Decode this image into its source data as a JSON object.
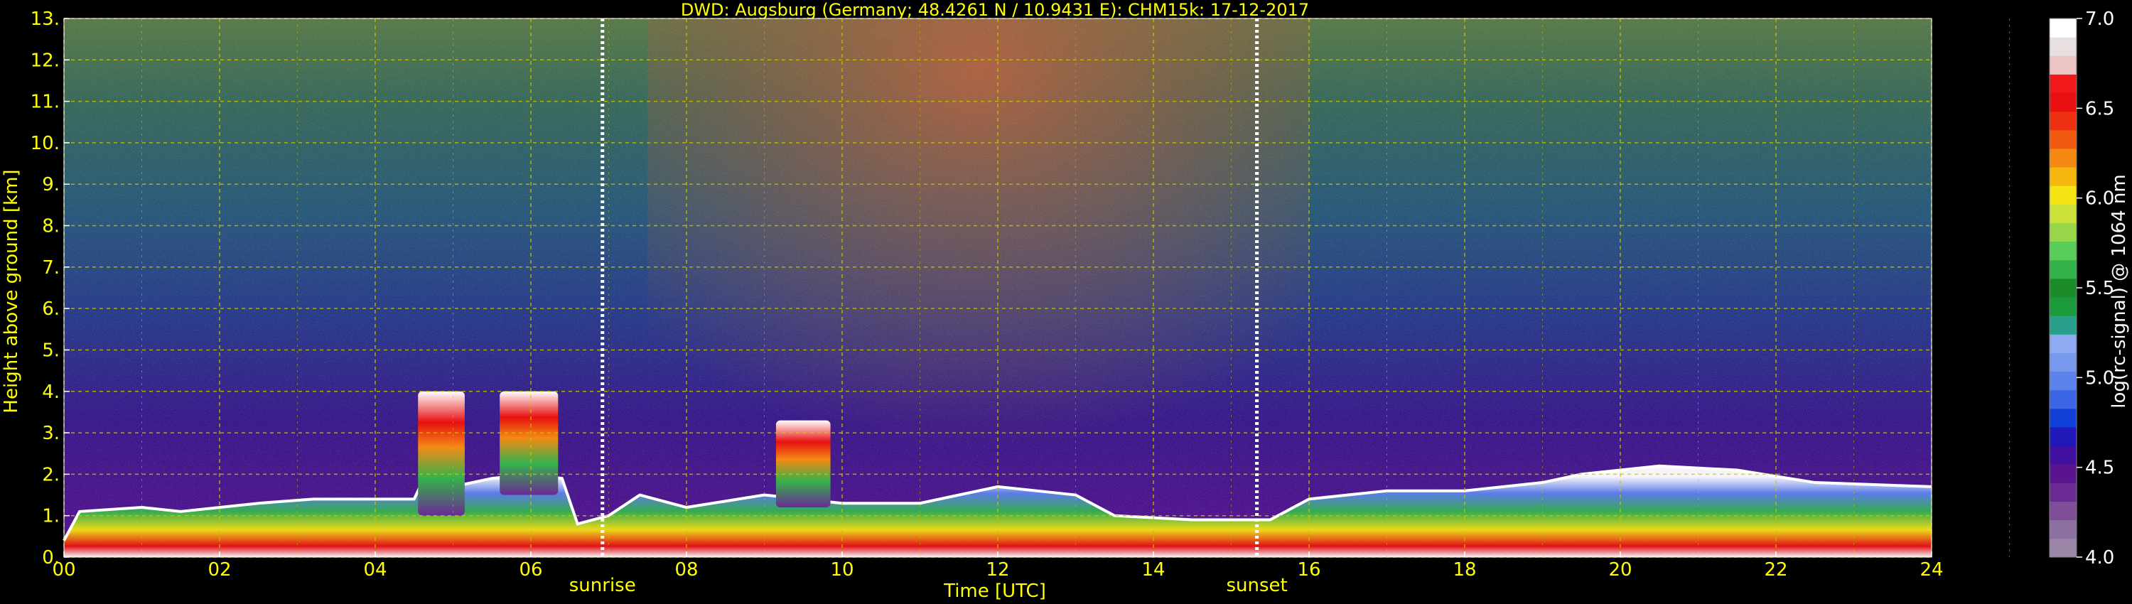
{
  "chart_data": {
    "type": "heatmap",
    "title": "DWD: Augsburg (Germany; 48.4261 N / 10.9431 E):    CHM15k: 17-12-2017",
    "xlabel": "Time [UTC]",
    "ylabel": "Height above ground [km]",
    "xlim": [
      0,
      24
    ],
    "ylim": [
      0,
      13
    ],
    "xticks": [
      0,
      2,
      4,
      6,
      8,
      10,
      12,
      14,
      16,
      18,
      20,
      22,
      24
    ],
    "xtick_labels": [
      "00",
      "02",
      "04",
      "06",
      "08",
      "10",
      "12",
      "14",
      "16",
      "18",
      "20",
      "22",
      "24"
    ],
    "yticks": [
      0,
      1,
      2,
      3,
      4,
      5,
      6,
      7,
      8,
      9,
      10,
      11,
      12,
      13
    ],
    "ytick_labels": [
      "0.",
      "1.",
      "2.",
      "3.",
      "4.",
      "5.",
      "6.",
      "7.",
      "8.",
      "9.",
      "10.",
      "11.",
      "12.",
      "13."
    ],
    "grid": true,
    "markers": [
      {
        "label": "sunrise",
        "x": 6.92
      },
      {
        "label": "sunset",
        "x": 15.33
      }
    ],
    "colorbar": {
      "label": "log(rc-signal) @ 1064 nm",
      "range": [
        4.0,
        7.0
      ],
      "ticks": [
        4.0,
        4.5,
        5.0,
        5.5,
        6.0,
        6.5,
        7.0
      ],
      "tick_labels": [
        "4.0",
        "4.5",
        "5.0",
        "5.5",
        "6.0",
        "6.5",
        "7.0"
      ],
      "colors": [
        "#9b86a8",
        "#8c70a0",
        "#7e4f98",
        "#6a2a94",
        "#5a1490",
        "#4010a0",
        "#2018b8",
        "#1040d8",
        "#3c66e6",
        "#5c82ec",
        "#7898ee",
        "#8eaaf0",
        "#2aa08c",
        "#1a9a3a",
        "#1c8c2a",
        "#34b24c",
        "#5acc5a",
        "#9ad64a",
        "#cce23a",
        "#f4e414",
        "#f6b810",
        "#f48a14",
        "#f05a10",
        "#ec3010",
        "#e81010",
        "#f01818",
        "#ecc4c4",
        "#e8e0e0",
        "#ffffff"
      ]
    },
    "boundary_layer": [
      {
        "x": 0.0,
        "top": 0.4
      },
      {
        "x": 0.2,
        "top": 1.1
      },
      {
        "x": 1.0,
        "top": 1.2
      },
      {
        "x": 1.5,
        "top": 1.1
      },
      {
        "x": 2.5,
        "top": 1.3
      },
      {
        "x": 3.2,
        "top": 1.4
      },
      {
        "x": 4.5,
        "top": 1.4
      },
      {
        "x": 4.6,
        "top": 1.8
      },
      {
        "x": 5.0,
        "top": 1.7
      },
      {
        "x": 5.5,
        "top": 1.9
      },
      {
        "x": 6.0,
        "top": 2.0
      },
      {
        "x": 6.4,
        "top": 1.9
      },
      {
        "x": 6.6,
        "top": 0.8
      },
      {
        "x": 7.0,
        "top": 1.0
      },
      {
        "x": 7.4,
        "top": 1.5
      },
      {
        "x": 8.0,
        "top": 1.2
      },
      {
        "x": 9.0,
        "top": 1.5
      },
      {
        "x": 10.0,
        "top": 1.3
      },
      {
        "x": 11.0,
        "top": 1.3
      },
      {
        "x": 12.0,
        "top": 1.7
      },
      {
        "x": 13.0,
        "top": 1.5
      },
      {
        "x": 13.5,
        "top": 1.0
      },
      {
        "x": 14.5,
        "top": 0.9
      },
      {
        "x": 15.5,
        "top": 0.9
      },
      {
        "x": 16.0,
        "top": 1.4
      },
      {
        "x": 17.0,
        "top": 1.6
      },
      {
        "x": 18.0,
        "top": 1.6
      },
      {
        "x": 19.0,
        "top": 1.8
      },
      {
        "x": 19.5,
        "top": 2.0
      },
      {
        "x": 20.5,
        "top": 2.2
      },
      {
        "x": 21.5,
        "top": 2.1
      },
      {
        "x": 22.5,
        "top": 1.8
      },
      {
        "x": 24.0,
        "top": 1.7
      }
    ],
    "cloud_blocks": [
      {
        "x0": 5.6,
        "x1": 6.35,
        "y0": 1.5,
        "y1": 4.0
      },
      {
        "x0": 4.55,
        "x1": 5.15,
        "y0": 1.0,
        "y1": 4.0
      },
      {
        "x0": 9.15,
        "x1": 9.85,
        "y0": 1.2,
        "y1": 3.3
      }
    ]
  }
}
